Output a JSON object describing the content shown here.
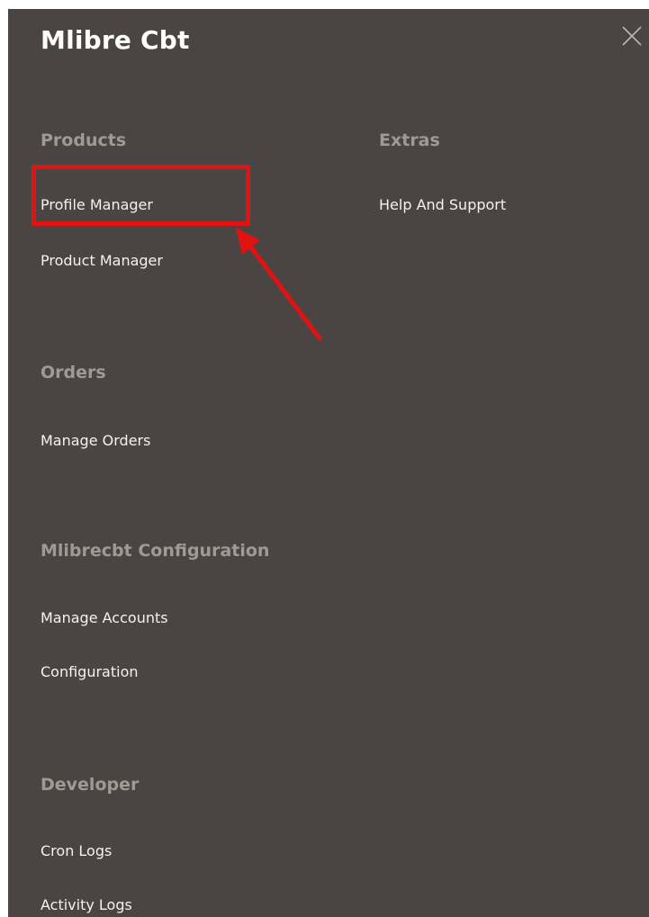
{
  "panel": {
    "title": "Mlibre Cbt",
    "background_color": "#4a4542",
    "close_icon": "close-icon"
  },
  "columns": {
    "left": {
      "sections": [
        {
          "title": "Products",
          "items": [
            "Profile Manager",
            "Product Manager"
          ]
        },
        {
          "title": "Orders",
          "items": [
            "Manage Orders"
          ]
        },
        {
          "title": "Mlibrecbt Configuration",
          "items": [
            "Manage Accounts",
            "Configuration"
          ]
        },
        {
          "title": "Developer",
          "items": [
            "Cron Logs",
            "Activity Logs"
          ]
        }
      ]
    },
    "right": {
      "sections": [
        {
          "title": "Extras",
          "items": [
            "Help And Support"
          ]
        }
      ]
    }
  },
  "annotation": {
    "highlighted_item": "Profile Manager",
    "color": "#e11212"
  }
}
